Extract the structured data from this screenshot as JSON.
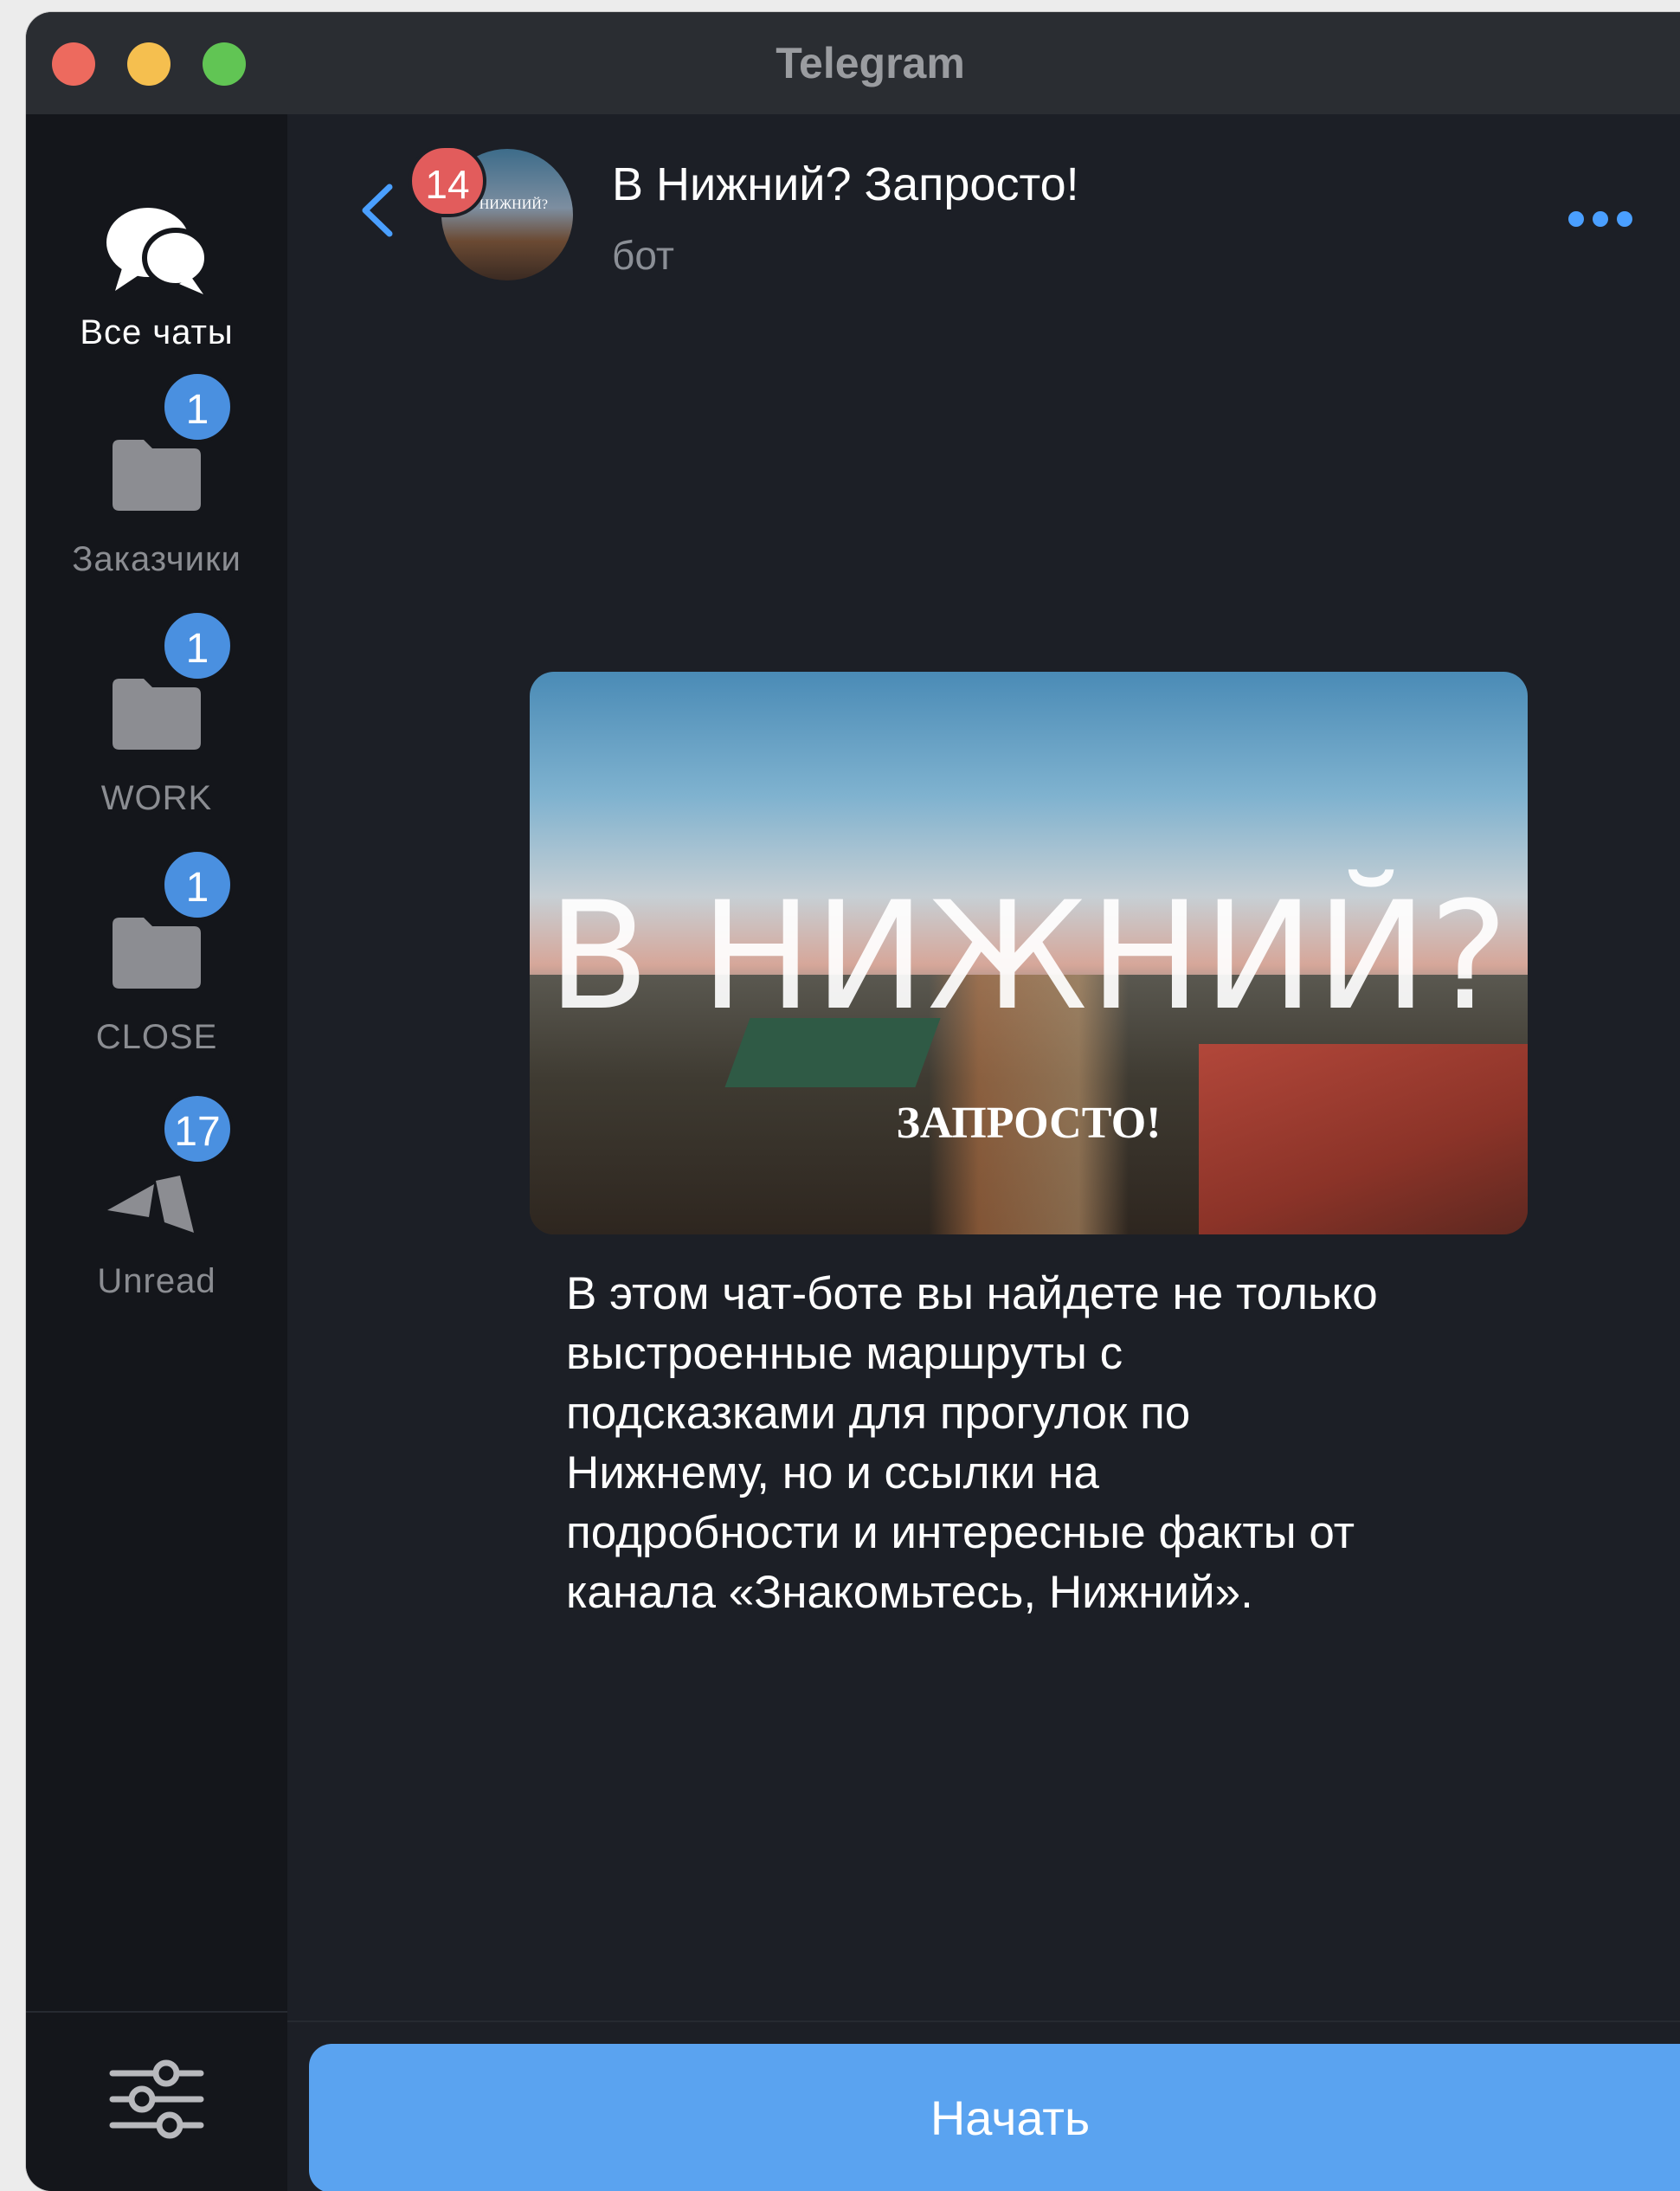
{
  "window": {
    "title": "Telegram"
  },
  "sidebar": {
    "folders": [
      {
        "label": "Все чаты",
        "icon": "chat-bubbles-icon",
        "badge": null,
        "active": true
      },
      {
        "label": "Заказчики",
        "icon": "folder-icon",
        "badge": "1"
      },
      {
        "label": "WORK",
        "icon": "folder-icon",
        "badge": "1"
      },
      {
        "label": "CLOSE",
        "icon": "folder-icon",
        "badge": "1"
      },
      {
        "label": "Unread",
        "icon": "unread-icon",
        "badge": "17"
      }
    ],
    "settings_icon": "sliders-icon"
  },
  "header": {
    "back_badge": "14",
    "avatar_text": "В НИЖНИЙ?",
    "chat_title": "В Нижний? Запросто!",
    "chat_subtitle": "бот",
    "more_icon": "more-dots-icon"
  },
  "bot_intro": {
    "image_title": "В НИЖНИЙ?",
    "image_subtitle": "ЗАПРОСТО!",
    "description": "В этом чат-боте вы найдете не только\nвыстроенные маршруты с\nподсказками для прогулок по\nНижнему, но и ссылки на\nподробности и интересные факты от\nканала «Знакомьтесь, Нижний»."
  },
  "footer": {
    "start_label": "Начать"
  },
  "colors": {
    "window_bg": "#1c1f26",
    "sidebar_bg": "#14161b",
    "accent": "#5aa3f0",
    "badge_blue": "#4a90e0",
    "badge_red": "#e25c5c"
  }
}
